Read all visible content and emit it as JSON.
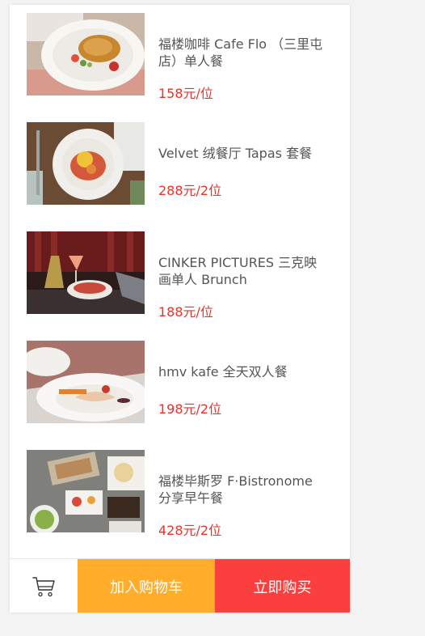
{
  "products": [
    {
      "title": "福楼咖啡 Cafe Flo （三里屯店）单人餐",
      "price": "158元/位"
    },
    {
      "title": "Velvet 绒餐厅 Tapas 套餐",
      "price": "288元/2位"
    },
    {
      "title": "CINKER PICTURES 三克映画单人 Brunch",
      "price": "188元/位"
    },
    {
      "title": "hmv kafe 全天双人餐",
      "price": "198元/2位"
    },
    {
      "title": "福楼毕斯罗 F·Bistronome 分享早午餐",
      "price": "428元/2位"
    }
  ],
  "actions": {
    "cart_icon": "shopping-cart-icon",
    "add_to_cart": "加入购物车",
    "buy_now": "立即购买"
  },
  "colors": {
    "price": "#e8332b",
    "add_to_cart_bg": "#ffad2a",
    "buy_now_bg": "#fb3f3f"
  }
}
